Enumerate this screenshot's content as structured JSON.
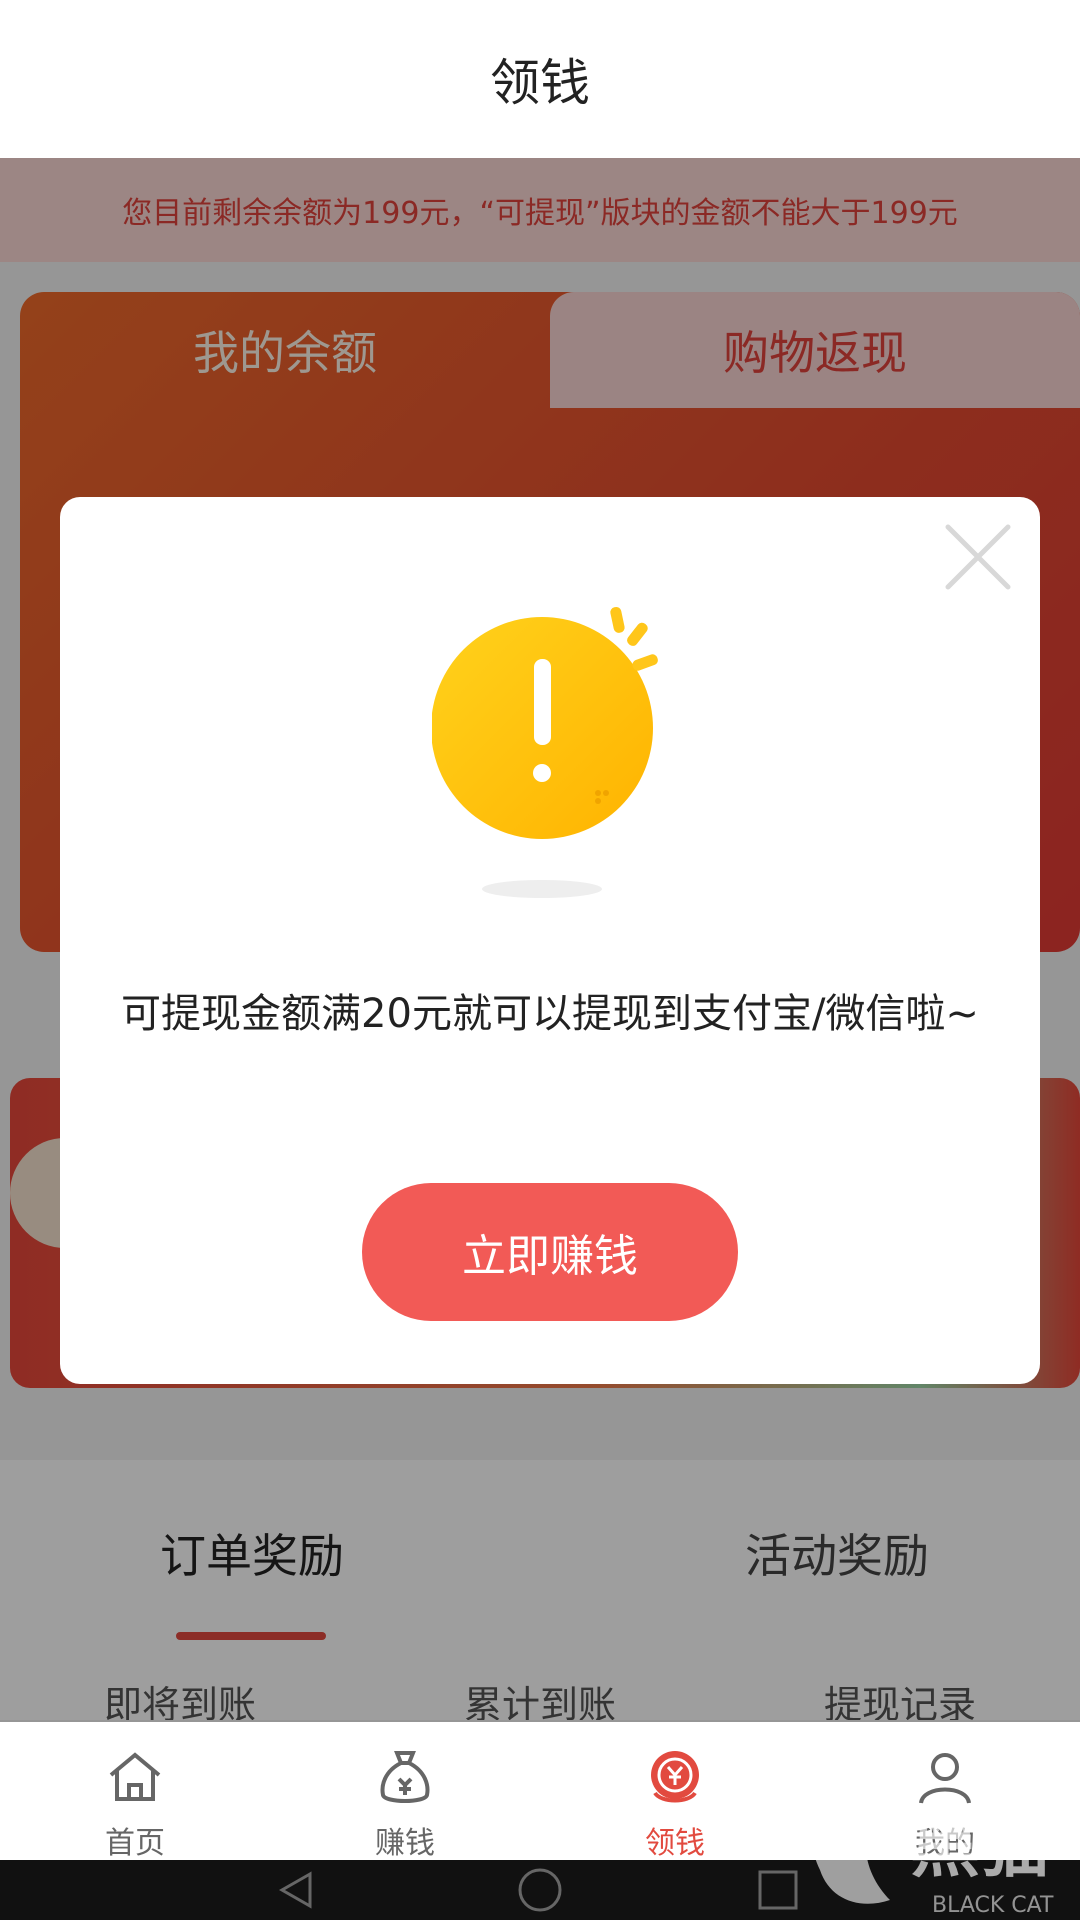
{
  "header": {
    "title": "领钱"
  },
  "notice": {
    "text": "您目前剩余余额为199元，“可提现”版块的金额不能大于199元"
  },
  "card": {
    "tabs": [
      {
        "label": "我的余额"
      },
      {
        "label": "购物返现"
      }
    ]
  },
  "rewards": {
    "tabs": [
      {
        "label": "订单奖励"
      },
      {
        "label": "活动奖励"
      }
    ],
    "subtabs": [
      {
        "label": "即将到账"
      },
      {
        "label": "累计到账"
      },
      {
        "label": "提现记录"
      }
    ]
  },
  "bottom_nav": {
    "items": [
      {
        "label": "首页",
        "icon": "home-icon"
      },
      {
        "label": "赚钱",
        "icon": "money-bag-icon"
      },
      {
        "label": "领钱",
        "icon": "coin-icon",
        "active": true
      },
      {
        "label": "我的",
        "icon": "user-icon"
      }
    ]
  },
  "dialog": {
    "icon": "exclamation-icon",
    "message": "可提现金额满20元就可以提现到支付宝/微信啦~",
    "button_label": "立即赚钱"
  },
  "watermark": {
    "text": "黑猫",
    "sub": "BLACK CAT"
  },
  "colors": {
    "accent": "#e24a3f",
    "button": "#f25a56",
    "icon_yellow": "#ffc61a"
  }
}
